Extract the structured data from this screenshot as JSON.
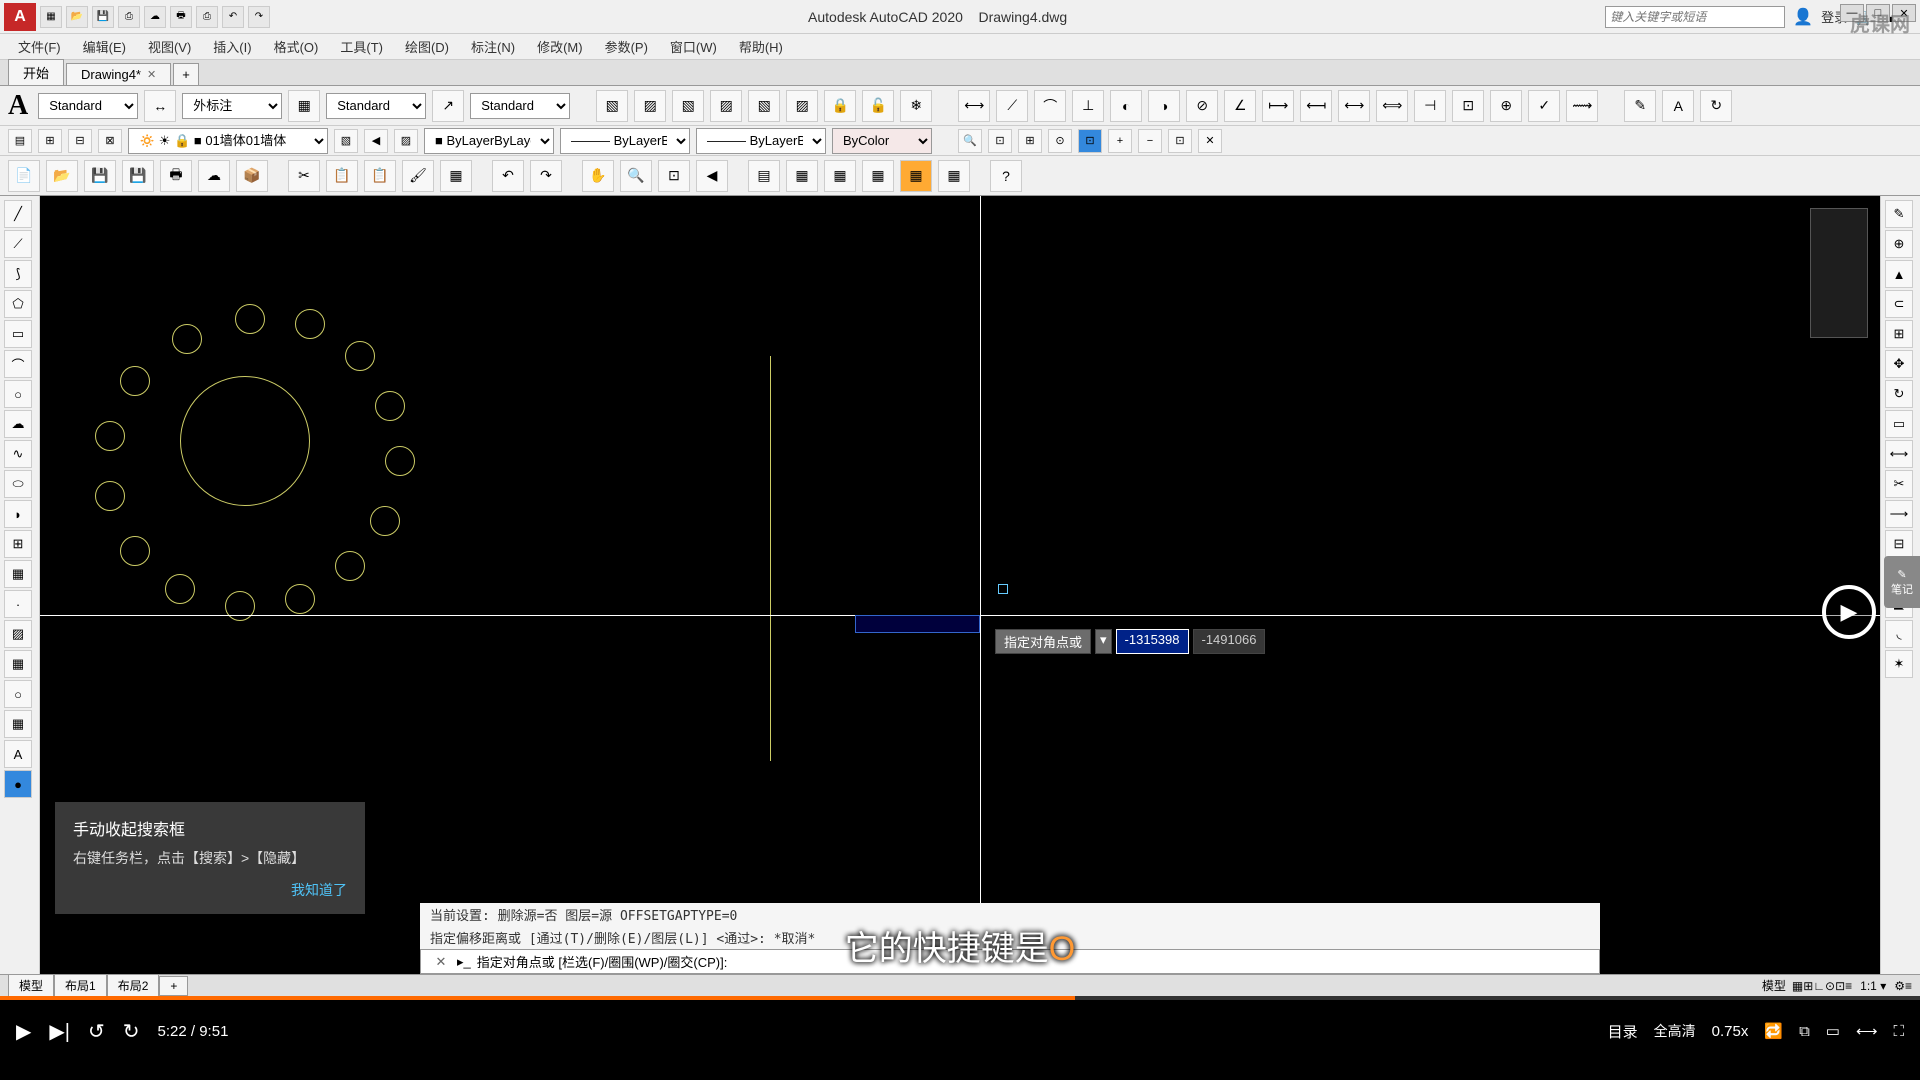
{
  "app": {
    "name": "Autodesk AutoCAD 2020",
    "file": "Drawing4.dwg",
    "search_placeholder": "键入关键字或短语",
    "login": "登录",
    "watermark": "虎课网"
  },
  "menubar": [
    "文件(F)",
    "编辑(E)",
    "视图(V)",
    "插入(I)",
    "格式(O)",
    "工具(T)",
    "绘图(D)",
    "标注(N)",
    "修改(M)",
    "参数(P)",
    "窗口(W)",
    "帮助(H)"
  ],
  "tabs": {
    "start": "开始",
    "doc": "Drawing4*"
  },
  "toolbar": {
    "text_style": "Standard",
    "dim_style": "外标注",
    "table_style": "Standard",
    "mleader_style": "Standard"
  },
  "layer": {
    "current": "01墙体",
    "linetype": "ByLayer",
    "lineweight": "ByLayer",
    "plot": "ByLayer",
    "bycolor": "ByColor"
  },
  "dynamic_input": {
    "label": "指定对角点或",
    "x": "-1315398",
    "y": "-1491066"
  },
  "cmd_history": {
    "l1": "当前设置: 删除源=否  图层=源  OFFSETGAPTYPE=0",
    "l2": "指定偏移距离或 [通过(T)/删除(E)/图层(L)] <通过>:  *取消*"
  },
  "cmd_prompt": "指定对角点或 [栏选(F)/圈围(WP)/圈交(CP)]:",
  "cmd_wp": "(WP)",
  "cmd_cp": "(CP)",
  "model_tabs": [
    "模型",
    "布局1",
    "布局2"
  ],
  "tooltip": {
    "title": "手动收起搜索框",
    "body": "右键任务栏，点击【搜索】>【隐藏】",
    "ok": "我知道了"
  },
  "subtitle": {
    "pre": "它的快捷键是",
    "key": "O"
  },
  "player": {
    "time_current": "5:22",
    "time_total": "9:51",
    "catalog": "目录",
    "quality": "全高清",
    "speed": "0.75x"
  },
  "side_note": "笔记"
}
